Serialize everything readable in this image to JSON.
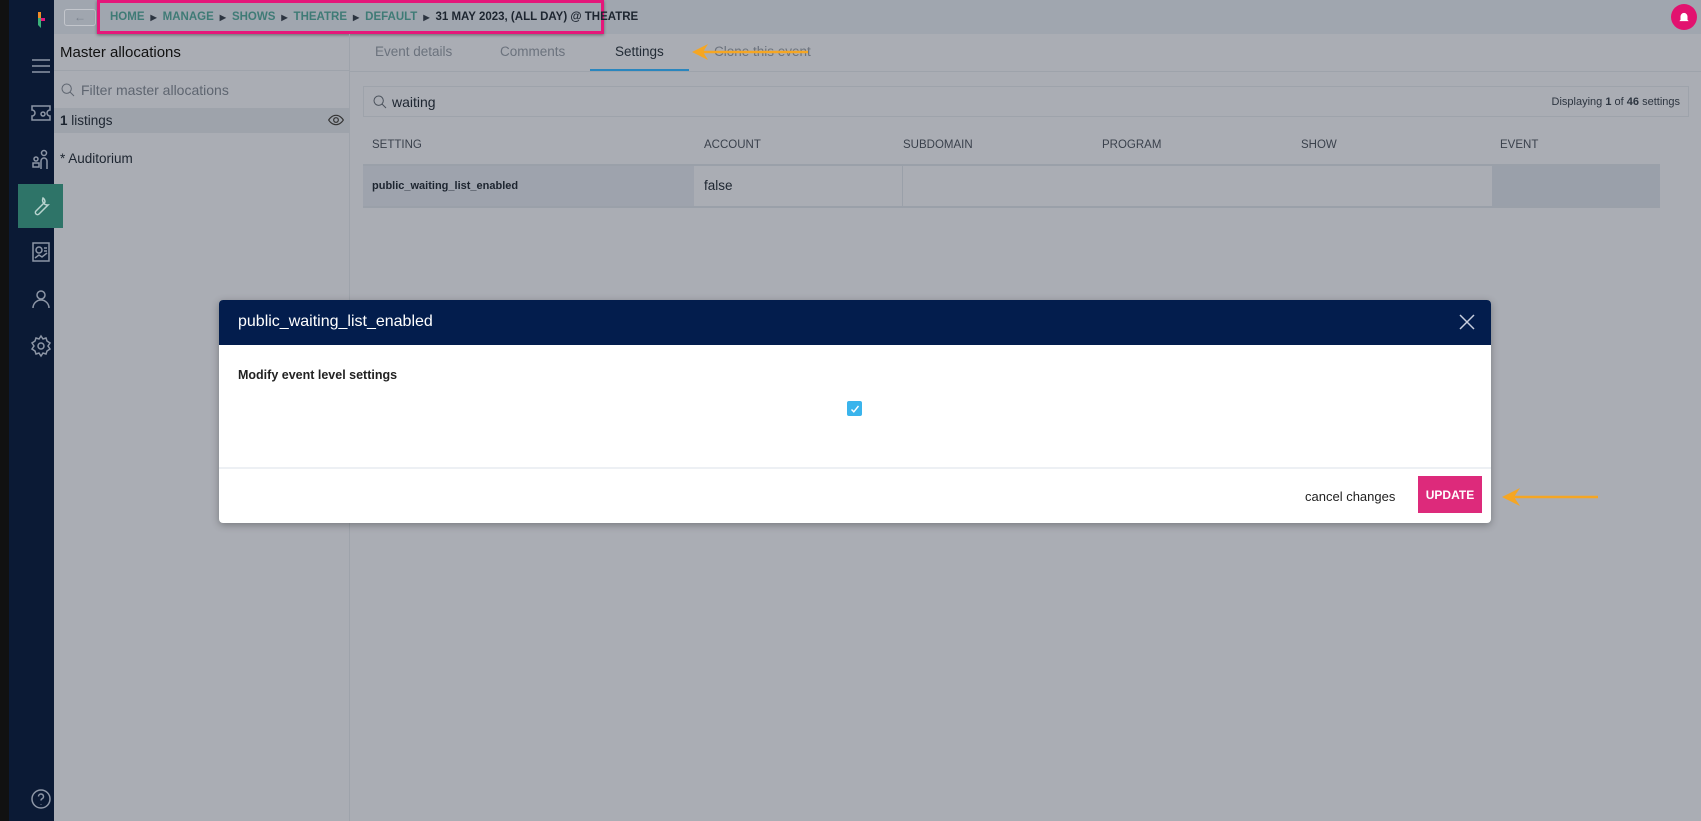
{
  "breadcrumb": [
    "HOME",
    "MANAGE",
    "SHOWS",
    "THEATRE",
    "DEFAULT"
  ],
  "breadcrumb_current": "31 MAY 2023, (ALL DAY) @ THEATRE",
  "back_label": "←",
  "sidebar": {
    "items": [
      "menu-icon",
      "ticket-icon",
      "people-icon",
      "wrench-icon",
      "report-icon",
      "user-icon",
      "gear-icon",
      "help-icon"
    ],
    "active": "wrench-icon",
    "active_color": "#2e7468"
  },
  "left_panel": {
    "title": "Master allocations",
    "filter_placeholder": "Filter master allocations",
    "listings_count": "1",
    "listings_label": " listings",
    "item": "* Auditorium"
  },
  "tabs": [
    "Event details",
    "Comments",
    "Settings",
    "Clone this event"
  ],
  "active_tab": "Settings",
  "search": {
    "value": "waiting",
    "displaying_prefix": "Displaying ",
    "displaying_shown": "1",
    "displaying_of": " of ",
    "displaying_total": "46",
    "displaying_suffix": " settings"
  },
  "table": {
    "headers": [
      "SETTING",
      "ACCOUNT",
      "SUBDOMAIN",
      "PROGRAM",
      "SHOW",
      "EVENT"
    ],
    "rows": [
      {
        "setting": "public_waiting_list_enabled",
        "account": "false",
        "subdomain": "",
        "program": "",
        "show": "",
        "event": ""
      }
    ]
  },
  "modal": {
    "title": "public_waiting_list_enabled",
    "label": "Modify event level settings",
    "checked": true,
    "cancel": "cancel changes",
    "update": "UPDATE"
  },
  "colors": {
    "accent": "#dd2a7b",
    "header": "#031d4d",
    "annotation_arrow": "#f5a623",
    "highlight_box": "#e5177a"
  }
}
